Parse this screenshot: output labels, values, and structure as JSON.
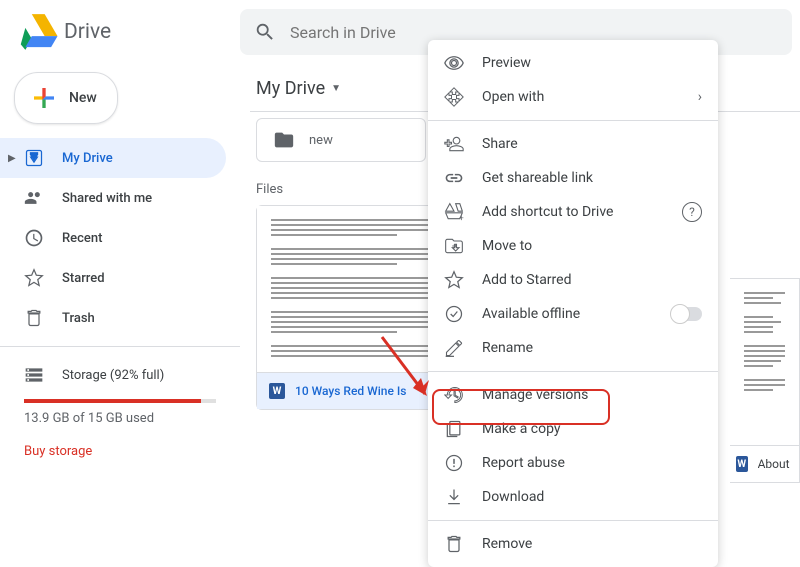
{
  "header": {
    "brand": "Drive",
    "search_placeholder": "Search in Drive"
  },
  "sidebar": {
    "new_label": "New",
    "items": [
      {
        "label": "My Drive",
        "icon": "drive"
      },
      {
        "label": "Shared with me",
        "icon": "shared"
      },
      {
        "label": "Recent",
        "icon": "clock"
      },
      {
        "label": "Starred",
        "icon": "star"
      },
      {
        "label": "Trash",
        "icon": "trash"
      }
    ],
    "storage_label": "Storage (92% full)",
    "storage_used": "13.9 GB of 15 GB used",
    "storage_percent": 92,
    "buy_label": "Buy storage"
  },
  "content": {
    "breadcrumb": "My Drive",
    "folder_name": "new",
    "section_label": "Files",
    "files": [
      {
        "name": "10 Ways Red Wine Is"
      },
      {
        "name": "About Us"
      }
    ]
  },
  "context_menu": {
    "groups": [
      [
        {
          "label": "Preview",
          "icon": "eye"
        },
        {
          "label": "Open with",
          "icon": "openwith",
          "submenu": true
        }
      ],
      [
        {
          "label": "Share",
          "icon": "share"
        },
        {
          "label": "Get shareable link",
          "icon": "link"
        },
        {
          "label": "Add shortcut to Drive",
          "icon": "shortcut",
          "help": true
        },
        {
          "label": "Move to",
          "icon": "moveto"
        },
        {
          "label": "Add to Starred",
          "icon": "star"
        },
        {
          "label": "Available offline",
          "icon": "offline",
          "toggle": true
        },
        {
          "label": "Rename",
          "icon": "rename"
        }
      ],
      [
        {
          "label": "Manage versions",
          "icon": "versions"
        },
        {
          "label": "Make a copy",
          "icon": "copy"
        },
        {
          "label": "Report abuse",
          "icon": "report"
        },
        {
          "label": "Download",
          "icon": "download"
        }
      ],
      [
        {
          "label": "Remove",
          "icon": "trash"
        }
      ]
    ]
  }
}
